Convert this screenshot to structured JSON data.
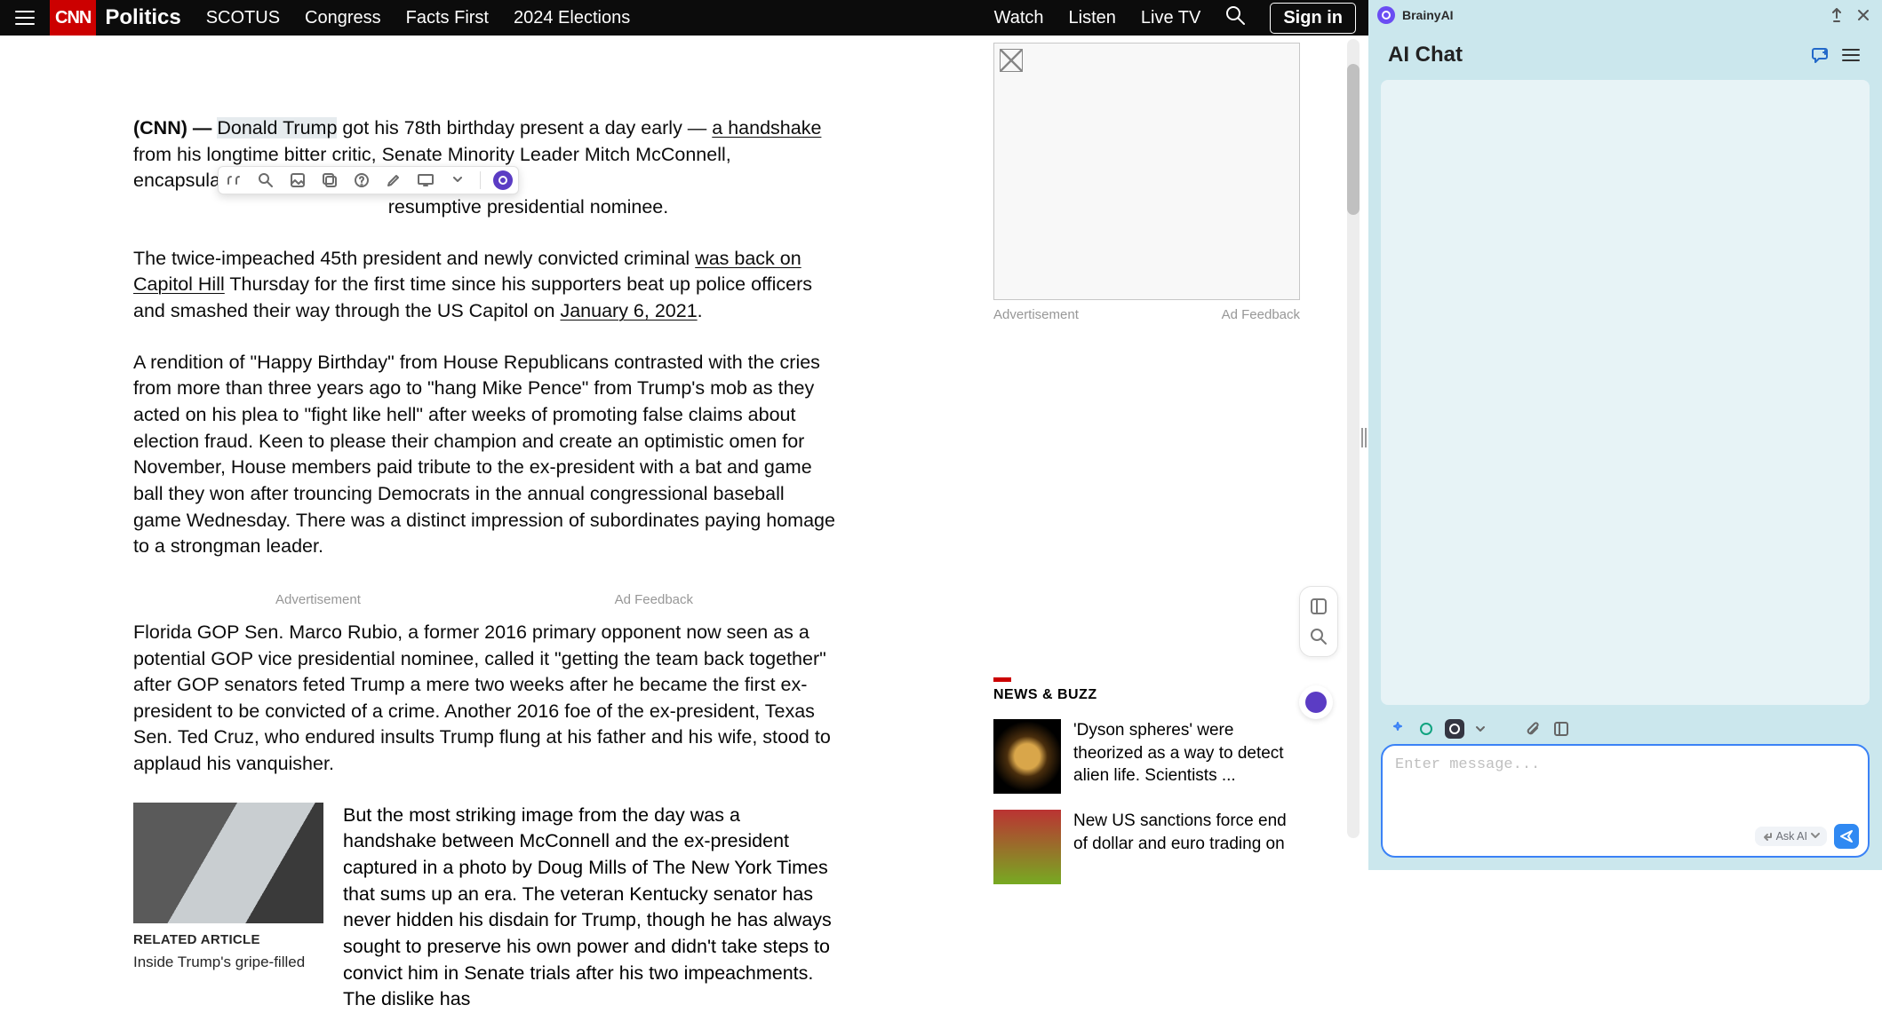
{
  "topbar": {
    "brand": "CNN",
    "brand_sub": "Politics",
    "links": [
      "SCOTUS",
      "Congress",
      "Facts First",
      "2024 Elections"
    ],
    "right": {
      "watch": "Watch",
      "listen": "Listen",
      "live": "Live TV"
    },
    "sign_in": "Sign in"
  },
  "article": {
    "source_prefix": "(CNN) — ",
    "p1_a": "Donald Trump",
    "p1_b": " got his 78th birthday present a day early — ",
    "p1_link1": "a handshake",
    "p1_c": " from his longtime bitter critic, Senate Minority Leader Mitch McConnell, encapsulating the Republican",
    "p1_gap": "                                                resumptive presidential nominee.",
    "p2_a": "The twice-impeached 45th president and newly convicted criminal ",
    "p2_link1": "was back on Capitol Hill",
    "p2_b": " Thursday for the first time since his supporters beat up police officers and smashed their way through the US Capitol on ",
    "p2_link2": "January 6, 2021",
    "p2_c": ".",
    "p3": "A rendition of \"Happy Birthday\" from House Republicans contrasted with the cries from more than three years ago to \"hang Mike Pence\" from Trump's mob as they acted on his plea to \"fight like hell\" after weeks of promoting false claims about election fraud. Keen to please their champion and create an optimistic omen for November, House members paid tribute to the ex-president with a bat and game ball they won after trouncing Democrats in the annual congressional baseball game Wednesday. There was a distinct impression of subordinates paying homage to a strongman leader.",
    "p4": "Florida GOP Sen. Marco Rubio, a former 2016 primary opponent now seen as a potential GOP vice presidential nominee, called it \"getting the team back together\" after GOP senators feted Trump a mere two weeks after he became the first ex-president to be convicted of a crime. Another 2016 foe of the ex-president, Texas Sen. Ted Cruz, who endured insults Trump flung at his father and his wife, stood to applaud his vanquisher.",
    "p5": "But the most striking image from the day was a handshake between McConnell and the ex-president captured in a photo by Doug Mills of The New York Times that sums up an era. The veteran Kentucky senator has never hidden his disdain for Trump, though he has always sought to preserve his own power and didn't take steps to convict him in Senate trials after his two impeachments. The dislike has"
  },
  "mid_ad": {
    "left": "Advertisement",
    "right": "Ad Feedback"
  },
  "related": {
    "tag": "RELATED ARTICLE",
    "title": "Inside Trump's gripe-filled"
  },
  "rail": {
    "ad": {
      "left": "Advertisement",
      "right": "Ad Feedback"
    },
    "nb_head": "NEWS & BUZZ",
    "items": [
      "'Dyson spheres' were theorized as a way to detect alien life. Scientists ...",
      "New US sanctions force end of dollar and euro trading on"
    ]
  },
  "panel": {
    "name": "BrainyAI",
    "title": "AI Chat",
    "placeholder": "Enter message...",
    "ask": "Ask AI"
  }
}
